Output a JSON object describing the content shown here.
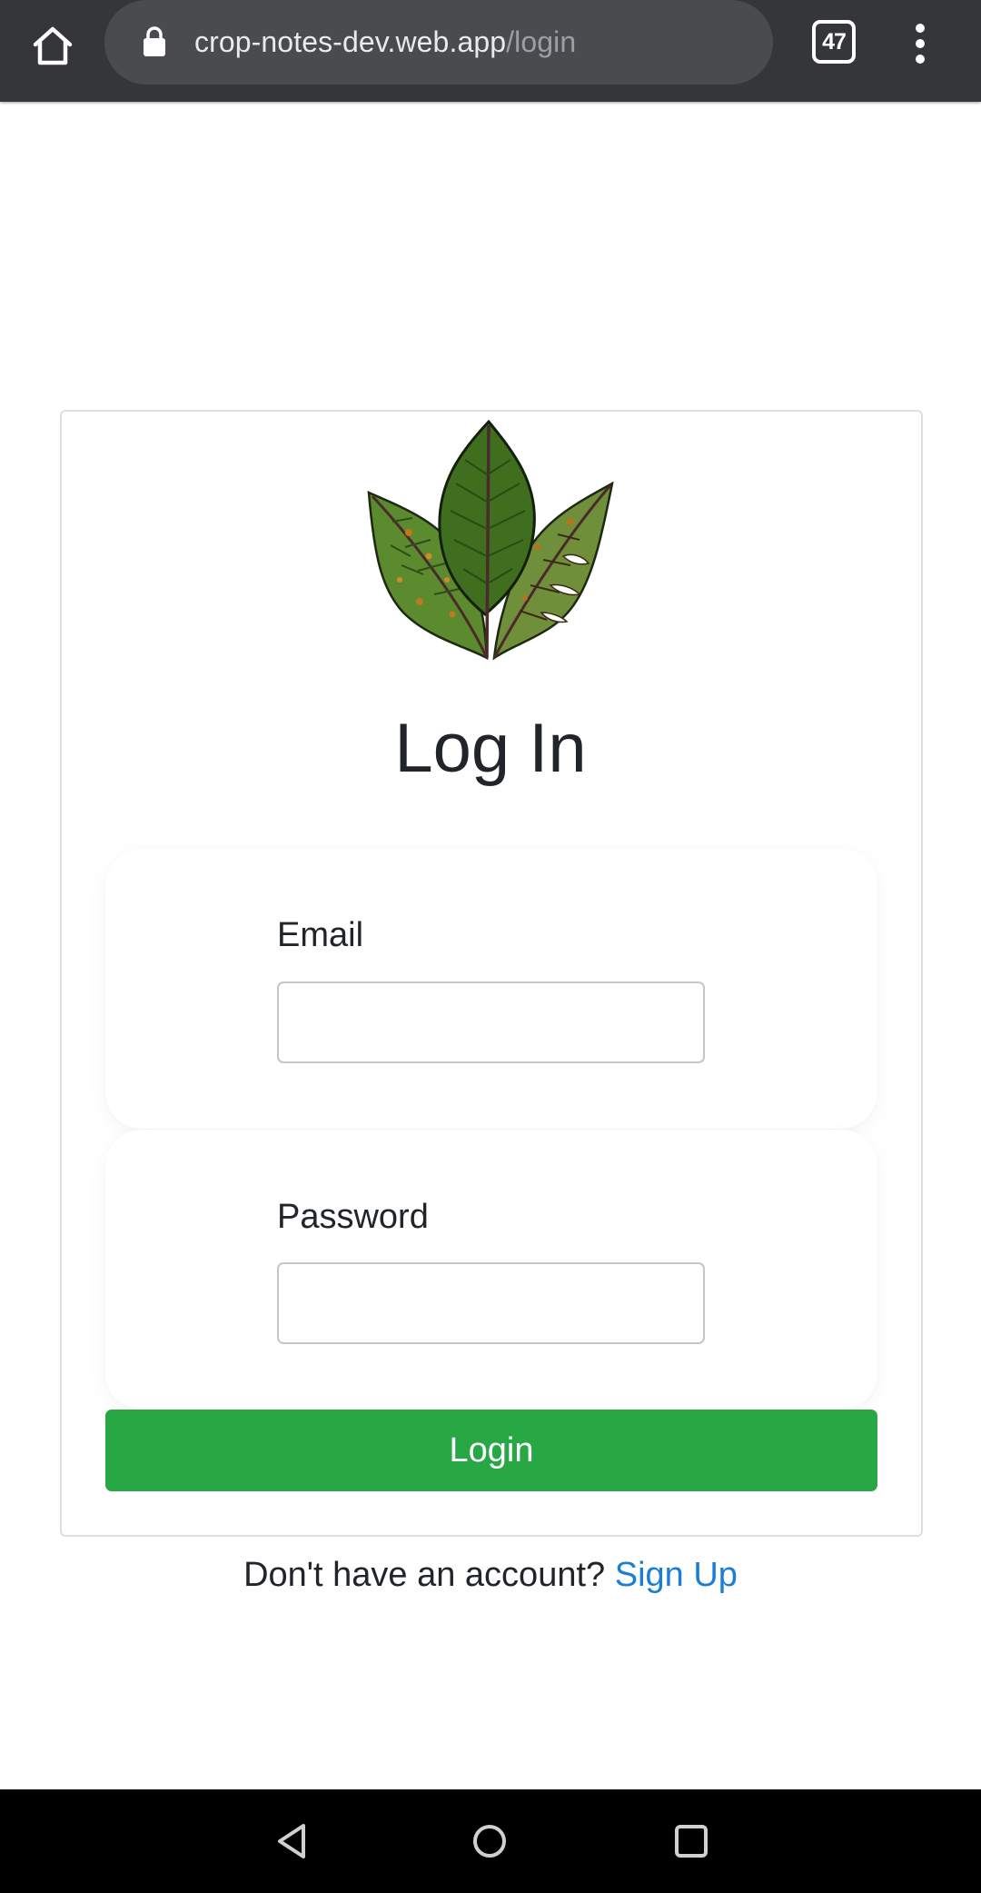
{
  "browser": {
    "url_host": "crop-notes-dev.web.app",
    "url_path": "/login",
    "tab_count": "47",
    "icons": [
      "home-icon",
      "lock-icon",
      "tabs-icon",
      "more-vert-icon"
    ]
  },
  "login": {
    "title": "Log In",
    "email_label": "Email",
    "email_value": "",
    "password_label": "Password",
    "password_value": "",
    "submit_label": "Login",
    "logo_icon": "leaves-logo"
  },
  "footer": {
    "prompt": "Don't have an account?",
    "signup_label": "Sign Up"
  },
  "colors": {
    "browser_bar": "#35363a",
    "url_pill": "#4a4b4f",
    "primary_button": "#28a745",
    "link": "#1a7fd4"
  },
  "android_nav": {
    "icons": [
      "back-icon",
      "home-circle-icon",
      "recents-icon"
    ]
  }
}
